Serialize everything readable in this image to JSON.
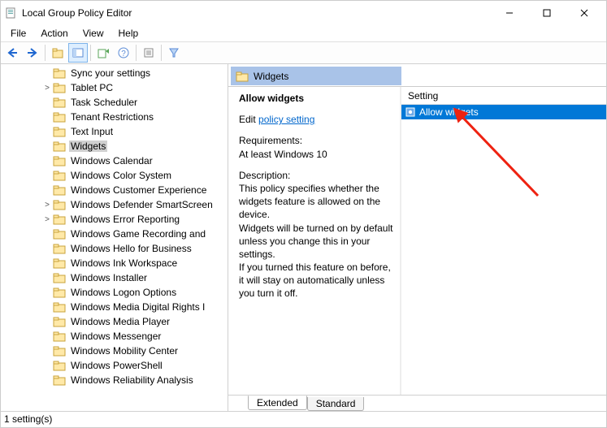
{
  "window": {
    "title": "Local Group Policy Editor"
  },
  "menu": {
    "file": "File",
    "action": "Action",
    "view": "View",
    "help": "Help"
  },
  "tree": {
    "items": [
      {
        "label": "Sync your settings",
        "twisty": "",
        "selected": false,
        "indent": 0
      },
      {
        "label": "Tablet PC",
        "twisty": ">",
        "selected": false,
        "indent": 0
      },
      {
        "label": "Task Scheduler",
        "twisty": "",
        "selected": false,
        "indent": 0
      },
      {
        "label": "Tenant Restrictions",
        "twisty": "",
        "selected": false,
        "indent": 0
      },
      {
        "label": "Text Input",
        "twisty": "",
        "selected": false,
        "indent": 0
      },
      {
        "label": "Widgets",
        "twisty": "",
        "selected": true,
        "indent": 0
      },
      {
        "label": "Windows Calendar",
        "twisty": "",
        "selected": false,
        "indent": 0
      },
      {
        "label": "Windows Color System",
        "twisty": "",
        "selected": false,
        "indent": 0
      },
      {
        "label": "Windows Customer Experience",
        "twisty": "",
        "selected": false,
        "indent": 0
      },
      {
        "label": "Windows Defender SmartScreen",
        "twisty": ">",
        "selected": false,
        "indent": 0
      },
      {
        "label": "Windows Error Reporting",
        "twisty": ">",
        "selected": false,
        "indent": 0
      },
      {
        "label": "Windows Game Recording and",
        "twisty": "",
        "selected": false,
        "indent": 0
      },
      {
        "label": "Windows Hello for Business",
        "twisty": "",
        "selected": false,
        "indent": 0
      },
      {
        "label": "Windows Ink Workspace",
        "twisty": "",
        "selected": false,
        "indent": 0
      },
      {
        "label": "Windows Installer",
        "twisty": "",
        "selected": false,
        "indent": 0
      },
      {
        "label": "Windows Logon Options",
        "twisty": "",
        "selected": false,
        "indent": 0
      },
      {
        "label": "Windows Media Digital Rights I",
        "twisty": "",
        "selected": false,
        "indent": 0
      },
      {
        "label": "Windows Media Player",
        "twisty": "",
        "selected": false,
        "indent": 0
      },
      {
        "label": "Windows Messenger",
        "twisty": "",
        "selected": false,
        "indent": 0
      },
      {
        "label": "Windows Mobility Center",
        "twisty": "",
        "selected": false,
        "indent": 0
      },
      {
        "label": "Windows PowerShell",
        "twisty": "",
        "selected": false,
        "indent": 0
      },
      {
        "label": "Windows Reliability Analysis",
        "twisty": "",
        "selected": false,
        "indent": 0
      }
    ]
  },
  "details": {
    "breadcrumb": "Widgets",
    "heading": "Allow widgets",
    "edit_prefix": "Edit",
    "edit_link": "policy setting",
    "req_label": "Requirements:",
    "req_value": "At least Windows 10",
    "desc_label": "Description:",
    "desc1": "This policy specifies whether the widgets feature is allowed on the device.",
    "desc2": "Widgets will be turned on by default unless you change this in your settings.",
    "desc3": "If you turned this feature on before, it will stay on automatically unless you turn it off."
  },
  "setting_list": {
    "header": "Setting",
    "selected_item": "Allow widgets"
  },
  "tabs": {
    "extended": "Extended",
    "standard": "Standard"
  },
  "status": {
    "text": "1 setting(s)"
  }
}
